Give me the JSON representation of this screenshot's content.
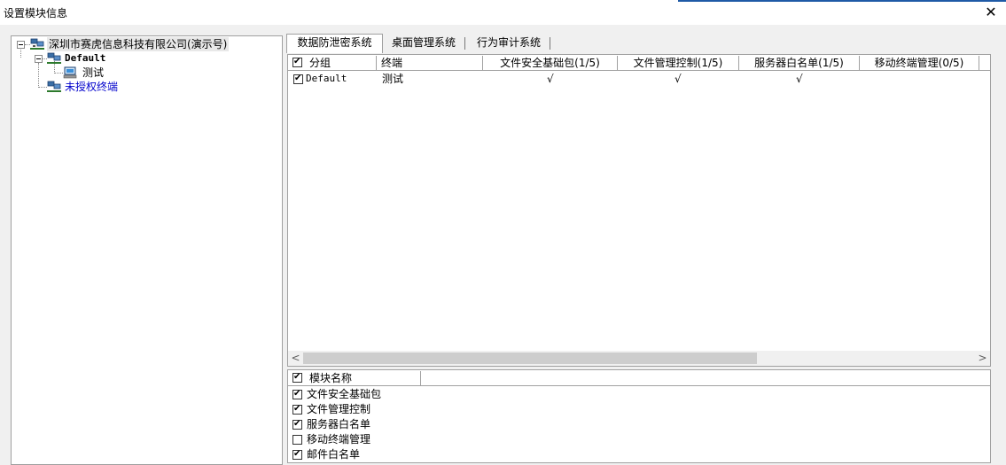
{
  "window": {
    "title": "设置模块信息",
    "close_label": "✕"
  },
  "tree": {
    "root": {
      "label": "深圳市赛虎信息科技有限公司(演示号)",
      "icon": "network-computers-icon"
    },
    "group": {
      "label": "Default",
      "icon": "network-computers-icon"
    },
    "terminal": {
      "label": "测试",
      "icon": "computer-monitor-icon"
    },
    "unauthorized": {
      "label": "未授权终端",
      "icon": "network-computers-icon"
    }
  },
  "tabs": [
    {
      "label": "数据防泄密系统",
      "active": true
    },
    {
      "label": "桌面管理系统",
      "active": false
    },
    {
      "label": "行为审计系统",
      "active": false
    }
  ],
  "grid": {
    "columns": [
      "分组",
      "终端",
      "文件安全基础包(1/5)",
      "文件管理控制(1/5)",
      "服务器白名单(1/5)",
      "移动终端管理(0/5)"
    ],
    "rows": [
      {
        "checked": true,
        "group": "Default",
        "terminal": "测试",
        "values": [
          "√",
          "√",
          "√",
          ""
        ]
      }
    ],
    "scroll_left": "<",
    "scroll_right": ">"
  },
  "modules": {
    "header": "模块名称",
    "items": [
      {
        "label": "文件安全基础包",
        "checked": true
      },
      {
        "label": "文件管理控制",
        "checked": true
      },
      {
        "label": "服务器白名单",
        "checked": true
      },
      {
        "label": "移动终端管理",
        "checked": false
      },
      {
        "label": "邮件白名单",
        "checked": true
      }
    ]
  }
}
